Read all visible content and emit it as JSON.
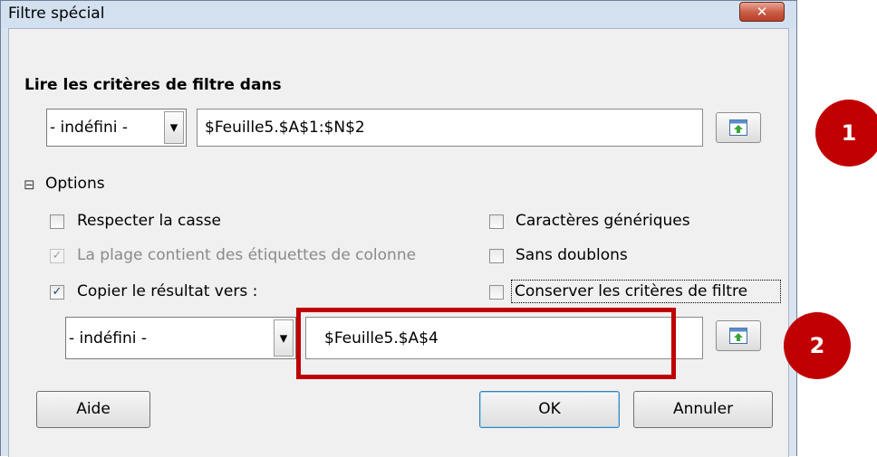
{
  "window": {
    "title": "Filtre spécial",
    "close_glyph": "✕"
  },
  "criteria": {
    "heading": "Lire les critères de filtre dans",
    "combo_value": "- indéfini -",
    "range_value": "$Feuille5.$A$1:$N$2"
  },
  "options": {
    "toggle_glyph": "⊟",
    "label": "Options",
    "respect_case": {
      "label": "Respecter la casse",
      "checked": false
    },
    "range_has_headers": {
      "label": "La plage contient des étiquettes de colonne",
      "checked": true,
      "enabled": false
    },
    "copy_results": {
      "label": "Copier le résultat vers :",
      "checked": true
    },
    "wildcards": {
      "label": "Caractères génériques",
      "checked": false
    },
    "no_duplicates": {
      "label": "Sans doublons",
      "checked": false
    },
    "keep_criteria": {
      "label": "Conserver les critères de filtre",
      "checked": false
    }
  },
  "output": {
    "combo_value": "- indéfini -",
    "range_value": "$Feuille5.$A$4"
  },
  "buttons": {
    "help": "Aide",
    "ok": "OK",
    "cancel": "Annuler"
  },
  "annotations": {
    "badge1": "1",
    "badge2": "2",
    "highlight_color": "#c00000"
  },
  "icons": {
    "dropdown": "▼",
    "check": "✓",
    "shrink": "shrink-dialog-icon"
  }
}
